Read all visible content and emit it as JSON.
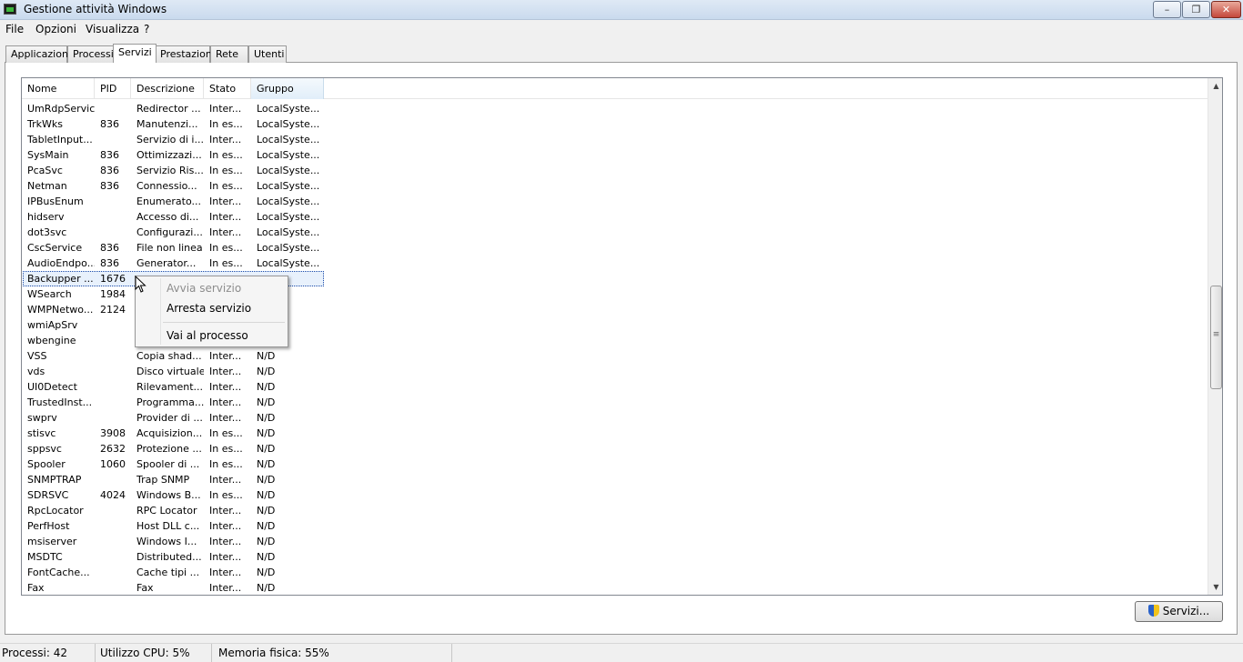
{
  "window": {
    "title": "Gestione attività Windows",
    "min": "–",
    "max": "❐",
    "close": "✕"
  },
  "menu": [
    "File",
    "Opzioni",
    "Visualizza",
    "?"
  ],
  "tabs": [
    "Applicazioni",
    "Processi",
    "Servizi",
    "Prestazioni",
    "Rete",
    "Utenti"
  ],
  "active_tab": "Servizi",
  "columns": [
    "Nome",
    "PID",
    "Descrizione",
    "Stato",
    "Gruppo"
  ],
  "sorted_column": "Gruppo",
  "rows": [
    [
      "UmRdpService",
      "",
      "Redirector ...",
      "Inter...",
      "LocalSyste..."
    ],
    [
      "TrkWks",
      "836",
      "Manutenzi...",
      "In es...",
      "LocalSyste..."
    ],
    [
      "TabletInput...",
      "",
      "Servizio di i...",
      "Inter...",
      "LocalSyste..."
    ],
    [
      "SysMain",
      "836",
      "Ottimizzazi...",
      "In es...",
      "LocalSyste..."
    ],
    [
      "PcaSvc",
      "836",
      "Servizio Ris...",
      "In es...",
      "LocalSyste..."
    ],
    [
      "Netman",
      "836",
      "Connessio...",
      "In es...",
      "LocalSyste..."
    ],
    [
      "IPBusEnum",
      "",
      "Enumerato...",
      "Inter...",
      "LocalSyste..."
    ],
    [
      "hidserv",
      "",
      "Accesso di...",
      "Inter...",
      "LocalSyste..."
    ],
    [
      "dot3svc",
      "",
      "Configurazi...",
      "Inter...",
      "LocalSyste..."
    ],
    [
      "CscService",
      "836",
      "File non linea",
      "In es...",
      "LocalSyste..."
    ],
    [
      "AudioEndpo...",
      "836",
      "Generator...",
      "In es...",
      "LocalSyste..."
    ],
    [
      "Backupper ...",
      "1676",
      "",
      "",
      ""
    ],
    [
      "WSearch",
      "1984",
      "",
      "",
      ""
    ],
    [
      "WMPNetwo...",
      "2124",
      "",
      "",
      ""
    ],
    [
      "wmiApSrv",
      "",
      "",
      "",
      ""
    ],
    [
      "wbengine",
      "",
      "",
      "",
      ""
    ],
    [
      "VSS",
      "",
      "Copia shad...",
      "Inter...",
      "N/D"
    ],
    [
      "vds",
      "",
      "Disco virtuale",
      "Inter...",
      "N/D"
    ],
    [
      "UI0Detect",
      "",
      "Rilevament...",
      "Inter...",
      "N/D"
    ],
    [
      "TrustedInst...",
      "",
      "Programma...",
      "Inter...",
      "N/D"
    ],
    [
      "swprv",
      "",
      "Provider di ...",
      "Inter...",
      "N/D"
    ],
    [
      "stisvc",
      "3908",
      "Acquisizion...",
      "In es...",
      "N/D"
    ],
    [
      "sppsvc",
      "2632",
      "Protezione ...",
      "In es...",
      "N/D"
    ],
    [
      "Spooler",
      "1060",
      "Spooler di ...",
      "In es...",
      "N/D"
    ],
    [
      "SNMPTRAP",
      "",
      "Trap SNMP",
      "Inter...",
      "N/D"
    ],
    [
      "SDRSVC",
      "4024",
      "Windows B...",
      "In es...",
      "N/D"
    ],
    [
      "RpcLocator",
      "",
      "RPC Locator",
      "Inter...",
      "N/D"
    ],
    [
      "PerfHost",
      "",
      "Host DLL c...",
      "Inter...",
      "N/D"
    ],
    [
      "msiserver",
      "",
      "Windows I...",
      "Inter...",
      "N/D"
    ],
    [
      "MSDTC",
      "",
      "Distributed...",
      "Inter...",
      "N/D"
    ],
    [
      "FontCache...",
      "",
      "Cache tipi ...",
      "Inter...",
      "N/D"
    ],
    [
      "Fax",
      "",
      "Fax",
      "Inter...",
      "N/D"
    ]
  ],
  "selected_row_index": 11,
  "context_menu": [
    {
      "label": "Avvia servizio",
      "enabled": false
    },
    {
      "label": "Arresta servizio",
      "enabled": true
    },
    {
      "label": "Vai al processo",
      "enabled": true
    }
  ],
  "services_button": "Servizi...",
  "status": {
    "processes": "Processi: 42",
    "cpu": "Utilizzo CPU: 5%",
    "memory": "Memoria fisica: 55%"
  }
}
